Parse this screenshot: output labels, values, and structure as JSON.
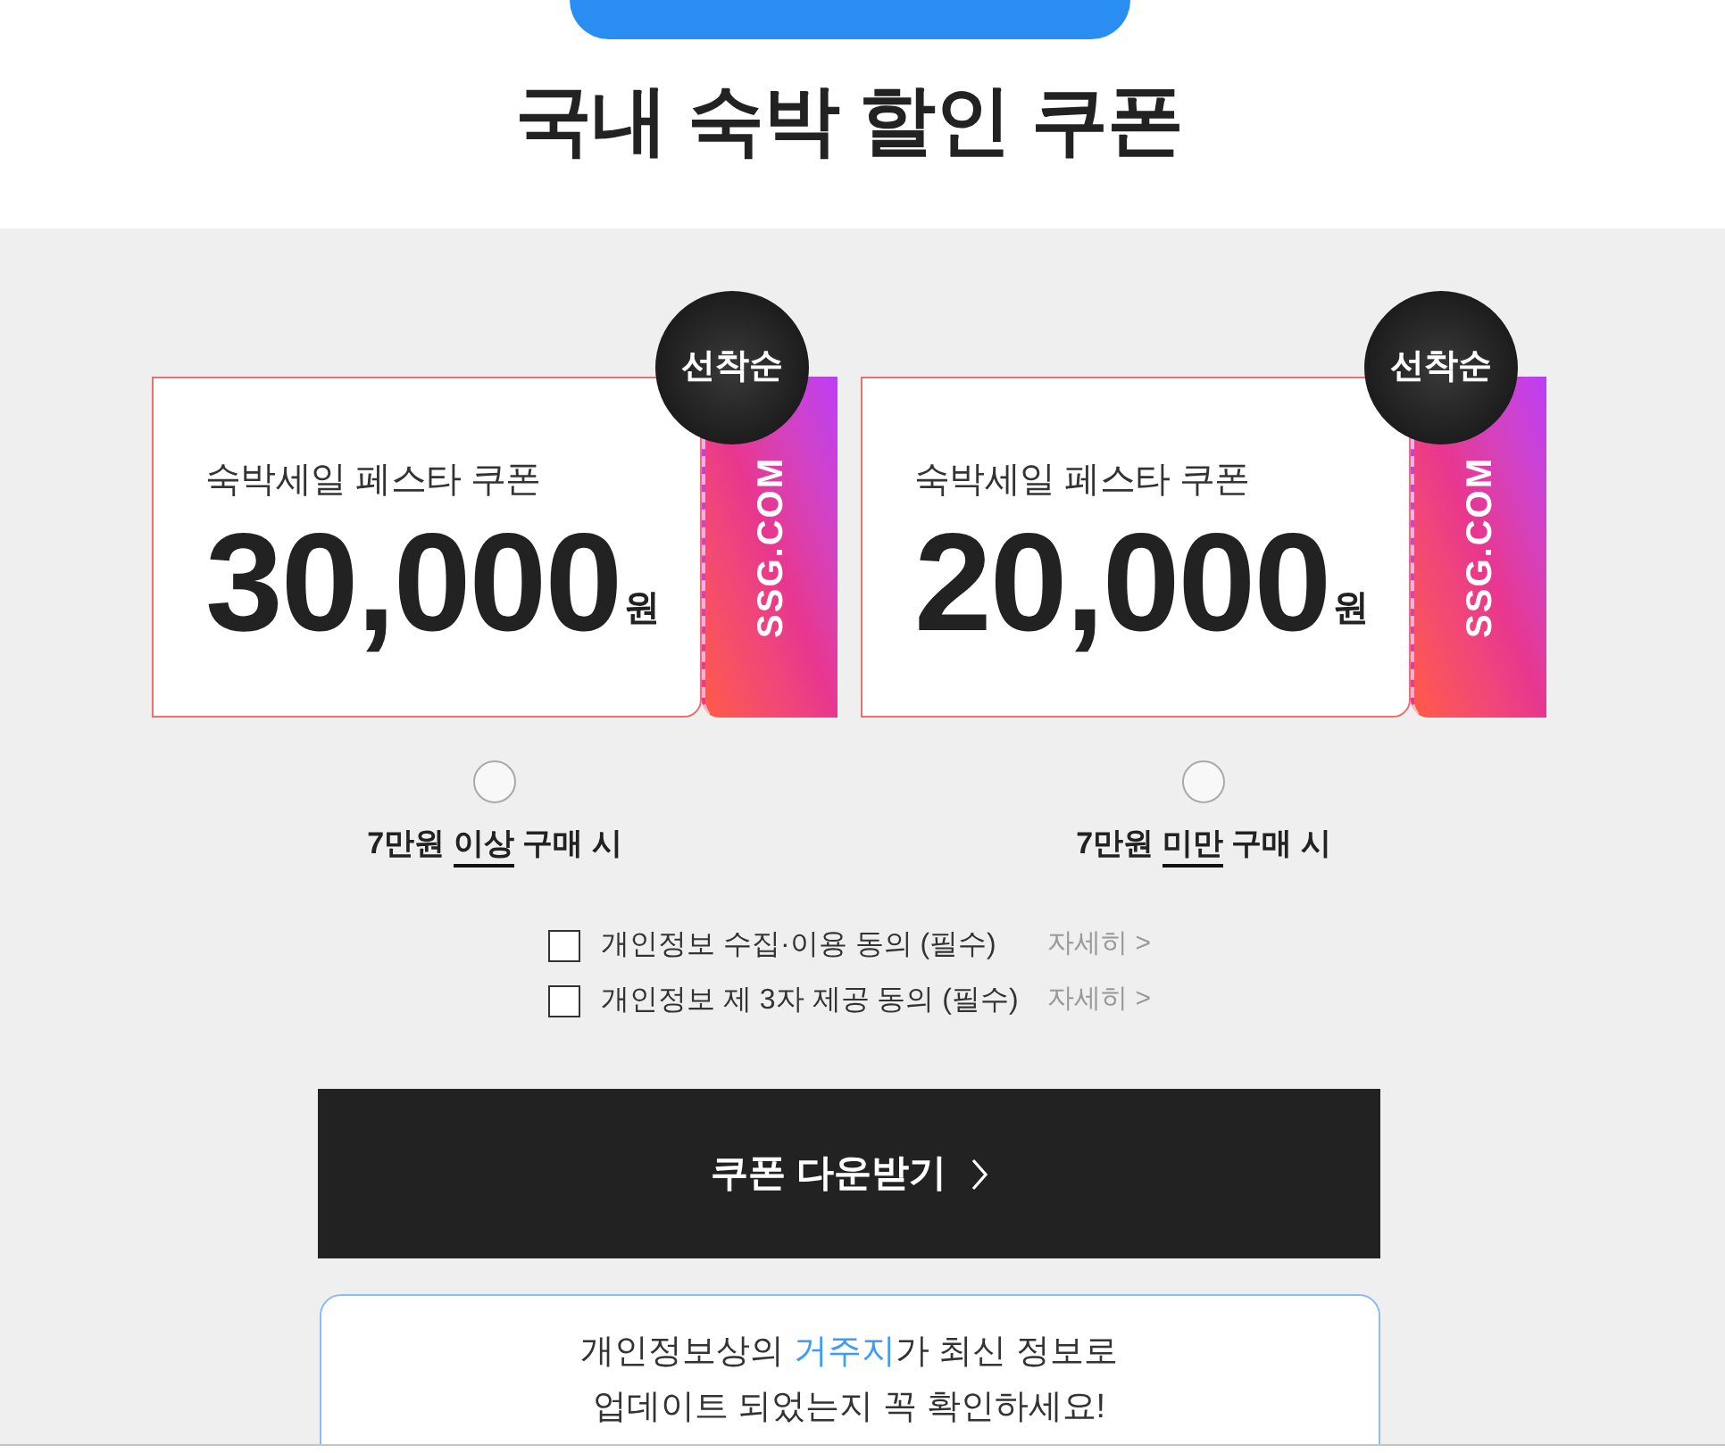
{
  "title": "국내 숙박 할인 쿠폰",
  "coupons": [
    {
      "badge": "선착순",
      "name": "숙박세일 페스타 쿠폰",
      "amount": "30,000",
      "unit": "원",
      "brand": "SSG.COM",
      "selected": false,
      "condition": {
        "before": "7만원",
        "underlined": "이상",
        "after": "구매 시"
      }
    },
    {
      "badge": "선착순",
      "name": "숙박세일 페스타 쿠폰",
      "amount": "20,000",
      "unit": "원",
      "brand": "SSG.COM",
      "selected": false,
      "condition": {
        "before": "7만원",
        "underlined": "미만",
        "after": "구매 시"
      }
    }
  ],
  "agreements": [
    {
      "label": "개인정보 수집·이용 동의 (필수)",
      "checked": false,
      "link": "자세히 >"
    },
    {
      "label": "개인정보 제 3자 제공 동의 (필수)",
      "checked": false,
      "link": "자세히 >"
    }
  ],
  "download_button": {
    "label": "쿠폰 다운받기"
  },
  "notice": {
    "lines": [
      [
        {
          "text": "개인정보상의 ",
          "highlighted": false
        },
        {
          "text": "거주지",
          "highlighted": true
        },
        {
          "text": "가 최신 정보로",
          "highlighted": false
        }
      ],
      [
        {
          "text": "업데이트 되었는지 꼭 확인하세요!",
          "highlighted": false
        }
      ]
    ]
  }
}
